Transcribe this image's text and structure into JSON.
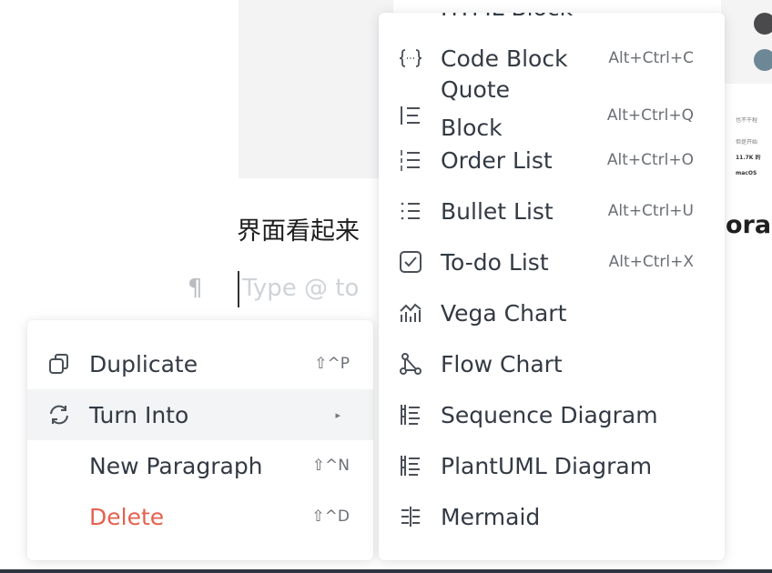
{
  "background": {
    "headline_prefix": "界面看起来",
    "headline_suffix": "ora",
    "paragraph_mark": "¶",
    "placeholder": "Type @ to",
    "tiny_lines": [
      "也不干程",
      "但是开始",
      "11.7K 的",
      "macOS"
    ]
  },
  "context_menu": {
    "items": [
      {
        "label": "Duplicate",
        "shortcut": "⇧^P",
        "icon": "duplicate-icon"
      },
      {
        "label": "Turn Into",
        "arrow": "▸",
        "icon": "refresh-icon",
        "state": "highlighted"
      },
      {
        "label": "New Paragraph",
        "shortcut": "⇧^N"
      },
      {
        "label": "Delete",
        "shortcut": "⇧^D",
        "color": "#e6614f"
      }
    ]
  },
  "turn_into_menu": {
    "partial_top_item": "HTML Block",
    "items": [
      {
        "label": "Code Block",
        "shortcut": "Alt+Ctrl+C",
        "icon": "code-braces-icon"
      },
      {
        "label_line1": "Quote",
        "label_line2": "Block",
        "shortcut": "Alt+Ctrl+Q",
        "icon": "quote-icon"
      },
      {
        "label": "Order List",
        "shortcut": "Alt+Ctrl+O",
        "icon": "ordered-list-icon"
      },
      {
        "label": "Bullet List",
        "shortcut": "Alt+Ctrl+U",
        "icon": "bullet-list-icon"
      },
      {
        "label": "To-do List",
        "shortcut": "Alt+Ctrl+X",
        "icon": "checkbox-icon"
      },
      {
        "label": "Vega Chart",
        "icon": "chart-icon"
      },
      {
        "label": "Flow Chart",
        "icon": "flow-icon"
      },
      {
        "label": "Sequence Diagram",
        "icon": "sequence-icon"
      },
      {
        "label": "PlantUML Diagram",
        "icon": "sequence-icon"
      },
      {
        "label": "Mermaid",
        "icon": "mermaid-icon"
      }
    ]
  },
  "colors": {
    "danger": "#e6614f",
    "highlight": "#f2f4f5",
    "text": "#333a44"
  }
}
